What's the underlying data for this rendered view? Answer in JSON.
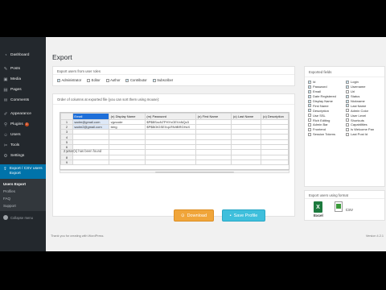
{
  "sidebar": {
    "items": [
      {
        "label": "Dashboard",
        "icon": "dashboard-icon",
        "glyph": "◔"
      },
      {
        "label": "Posts",
        "icon": "pushpin-icon",
        "glyph": "✎"
      },
      {
        "label": "Media",
        "icon": "media-icon",
        "glyph": "▣"
      },
      {
        "label": "Pages",
        "icon": "page-icon",
        "glyph": "▤"
      },
      {
        "label": "Comments",
        "icon": "comment-icon",
        "glyph": "✉"
      },
      {
        "label": "Appearance",
        "icon": "brush-icon",
        "glyph": "✐"
      },
      {
        "label": "Plugins",
        "icon": "plugin-icon",
        "glyph": "⚲",
        "badge": "1"
      },
      {
        "label": "Users",
        "icon": "users-icon",
        "glyph": "☺"
      },
      {
        "label": "Tools",
        "icon": "wrench-icon",
        "glyph": "✂"
      },
      {
        "label": "Settings",
        "icon": "settings-icon",
        "glyph": "⚙"
      }
    ],
    "active": {
      "label": "Export / CSV users Export",
      "icon": "export-icon",
      "glyph": "⇪"
    },
    "submenu": [
      "Users Export",
      "Profiles",
      "FAQ",
      "Support"
    ],
    "collapse_label": "Collapse menu"
  },
  "main": {
    "title": "Export",
    "roles": {
      "header": "Export users from user roles",
      "items": [
        {
          "label": "Administrator",
          "checked": true
        },
        {
          "label": "Editor",
          "checked": false
        },
        {
          "label": "Author",
          "checked": false
        },
        {
          "label": "Contributor",
          "checked": true
        },
        {
          "label": "Subscriber",
          "checked": true
        }
      ]
    },
    "order": {
      "header": "Order of columns at exported file (you can sort them using mouse):",
      "columns": [
        "Email",
        "(n) Display Name",
        "(m) Password",
        "(n) First Name",
        "(o) Last Name",
        "(o) Description"
      ],
      "rows": [
        [
          "1",
          "sadm@gmail.com",
          "vgvcode",
          "$P$BSxcN7PHYxOEVxNQc3"
        ],
        [
          "2",
          "sadm2@gmail.com",
          "berg",
          "$P$BOtGSEXqLRN/tBRGHzX"
        ],
        [
          "3",
          "",
          "",
          ""
        ],
        [
          "4",
          "",
          "",
          ""
        ],
        [
          "5",
          "",
          "",
          ""
        ],
        [
          "6",
          "",
          "",
          ""
        ],
        [
          "7",
          "",
          "",
          ""
        ],
        [
          "8",
          "",
          "",
          ""
        ],
        [
          "9",
          "",
          "",
          ""
        ]
      ],
      "found_text": "2 User(s) has been found"
    },
    "fields": {
      "header": "Exported fields",
      "left": [
        {
          "label": "Id",
          "checked": true
        },
        {
          "label": "Password",
          "checked": true
        },
        {
          "label": "Email",
          "checked": true
        },
        {
          "label": "Date Registered",
          "checked": true
        },
        {
          "label": "Display Name",
          "checked": true
        },
        {
          "label": "First Name",
          "checked": true
        },
        {
          "label": "Description",
          "checked": true
        },
        {
          "label": "Use SSL",
          "checked": false
        },
        {
          "label": "Rich Editing",
          "checked": false
        },
        {
          "label": "Admin Bar",
          "checked": false
        },
        {
          "label": "Frontend",
          "checked": false
        },
        {
          "label": "Session Tokens",
          "checked": false
        }
      ],
      "right": [
        {
          "label": "Login",
          "checked": true
        },
        {
          "label": "Username",
          "checked": true
        },
        {
          "label": "Url",
          "checked": false
        },
        {
          "label": "Status",
          "checked": true
        },
        {
          "label": "Nickname",
          "checked": true
        },
        {
          "label": "Last Name",
          "checked": true
        },
        {
          "label": "Admin Color",
          "checked": false
        },
        {
          "label": "User Level",
          "checked": false
        },
        {
          "label": "Shortcuts",
          "checked": false
        },
        {
          "label": "Capabilities",
          "checked": false
        },
        {
          "label": "Is Welcome Pan",
          "checked": false
        },
        {
          "label": "Last Post Id",
          "checked": false
        }
      ]
    },
    "format": {
      "header": "Export users using format",
      "options": [
        {
          "label": "Excel",
          "icon": "excel-icon",
          "glyph": "X"
        },
        {
          "label": "CSV",
          "icon": "csv-icon",
          "glyph": ""
        }
      ]
    },
    "buttons": {
      "download": "Download",
      "save_profile": "Save Profile"
    },
    "footer": {
      "left": "Thank you for creating with WordPress.",
      "right": "Version 4.2.1"
    }
  },
  "colors": {
    "sidebar_bg": "#23282d",
    "active_bg": "#0073aa",
    "download_btn": "#f0a53a",
    "save_btn": "#3fbfdc",
    "selected_header": "#1e6fd9"
  }
}
